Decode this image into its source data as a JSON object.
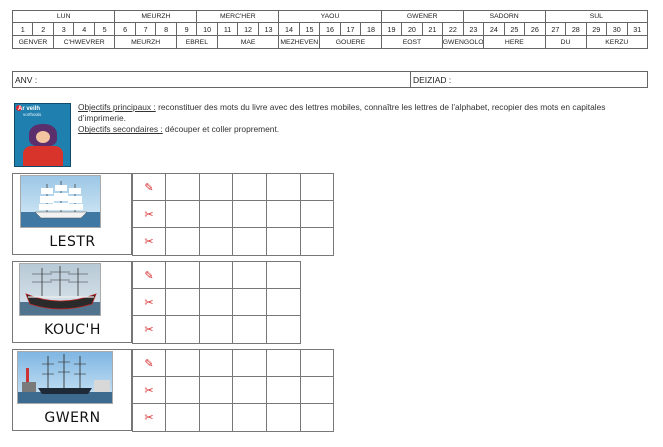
{
  "calendar": {
    "days": [
      {
        "label": "LUN",
        "span": 5
      },
      {
        "label": "MEURZH",
        "span": 4
      },
      {
        "label": "MERC'HER",
        "span": 4
      },
      {
        "label": "YAOU",
        "span": 5
      },
      {
        "label": "GWENER",
        "span": 4
      },
      {
        "label": "SADORN",
        "span": 4
      },
      {
        "label": "SUL",
        "span": 5
      }
    ],
    "numbers": [
      "1",
      "2",
      "3",
      "4",
      "5",
      "6",
      "7",
      "8",
      "9",
      "10",
      "11",
      "12",
      "13",
      "14",
      "15",
      "16",
      "17",
      "18",
      "19",
      "20",
      "21",
      "22",
      "23",
      "24",
      "25",
      "26",
      "27",
      "28",
      "29",
      "30",
      "31"
    ],
    "months": [
      {
        "label": "GENVER",
        "span": 2
      },
      {
        "label": "C'HWEVRER",
        "span": 3
      },
      {
        "label": "MEURZH",
        "span": 3
      },
      {
        "label": "EBREL",
        "span": 2
      },
      {
        "label": "MAE",
        "span": 3
      },
      {
        "label": "MEZHEVEN",
        "span": 2
      },
      {
        "label": "GOUERE",
        "span": 3
      },
      {
        "label": "EOST",
        "span": 3
      },
      {
        "label": "GWENGOLO",
        "span": 2
      },
      {
        "label": "HERE",
        "span": 3
      },
      {
        "label": "DU",
        "span": 2
      },
      {
        "label": "KERZU",
        "span": 3
      }
    ]
  },
  "namebar": {
    "anv": "ANV :",
    "deiziad": "DEIZIAD :"
  },
  "book": {
    "title": "Ar veilh",
    "subtitle": "vorthoüis"
  },
  "objectives": {
    "primary_label": "Objectifs principaux :",
    "primary_text": " reconstituer des mots du livre avec des lettres mobiles, connaître les lettres de l’alphabet, recopier des mots en capitales d’imprimerie.",
    "secondary_label": "Objectifs secondaires :",
    "secondary_text": " découper et coller proprement."
  },
  "cards": [
    {
      "word": "LESTR",
      "icons": [
        "pencil-icon",
        "scissors-icon",
        "scissors-icon"
      ]
    },
    {
      "word": "KOUC'H",
      "icons": [
        "pencil-icon",
        "scissors-icon",
        "scissors-icon"
      ]
    },
    {
      "word": "GWERN",
      "icons": [
        "pencil-icon",
        "scissors-icon",
        "scissors-icon"
      ]
    }
  ],
  "colors": {
    "icon_red": "#d62b2b",
    "border": "#666666"
  }
}
